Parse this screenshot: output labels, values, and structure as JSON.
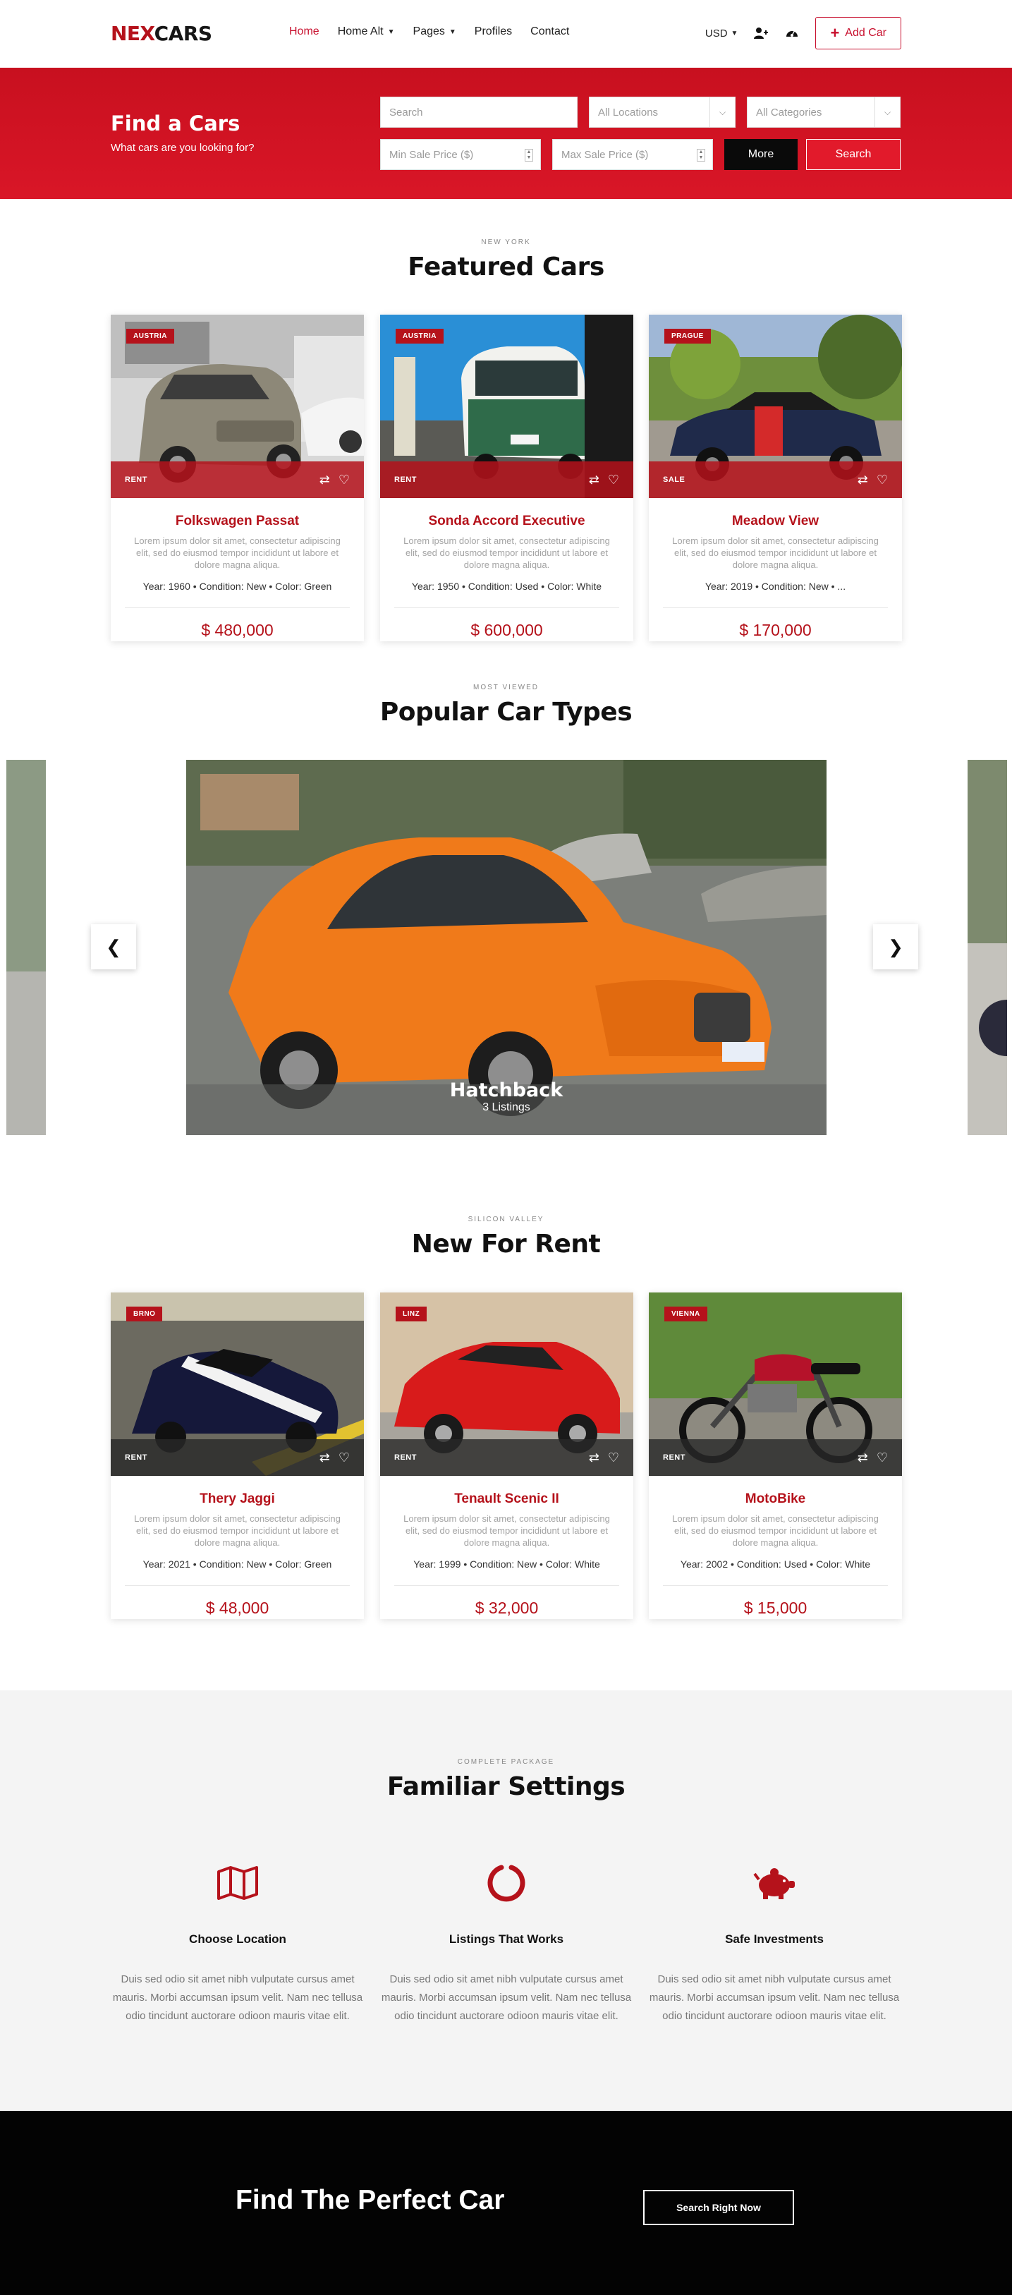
{
  "header": {
    "logo_part1": "NEX",
    "logo_part2": "CARS",
    "nav": [
      "Home",
      "Home Alt",
      "Pages",
      "Profiles",
      "Contact"
    ],
    "currency": "USD",
    "add_car_label": "Add Car"
  },
  "search": {
    "title": "Find a Cars",
    "subtitle": "What cars are you looking for?",
    "search_placeholder": "Search",
    "locations_placeholder": "All Locations",
    "categories_placeholder": "All Categories",
    "min_price_placeholder": "Min Sale Price ($)",
    "max_price_placeholder": "Max Sale Price ($)",
    "more_label": "More",
    "search_label": "Search"
  },
  "featured": {
    "eyebrow": "NEW YORK",
    "title": "Featured Cars",
    "cards": [
      {
        "tag": "AUSTRIA",
        "type": "RENT",
        "name": "Folkswagen Passat",
        "desc": "Lorem ipsum dolor sit amet, consectetur adipiscing elit, sed do eiusmod tempor incididunt ut labore et dolore magna aliqua.",
        "specs": "Year: 1960  •  Condition: New  •  Color: Green",
        "price": "$ 480,000"
      },
      {
        "tag": "AUSTRIA",
        "type": "RENT",
        "name": "Sonda Accord Executive",
        "desc": "Lorem ipsum dolor sit amet, consectetur adipiscing elit, sed do eiusmod tempor incididunt ut labore et dolore magna aliqua.",
        "specs": "Year: 1950  •  Condition: Used  •  Color: White",
        "price": "$ 600,000"
      },
      {
        "tag": "PRAGUE",
        "type": "SALE",
        "name": "Meadow View",
        "desc": "Lorem ipsum dolor sit amet, consectetur adipiscing elit, sed do eiusmod tempor incididunt ut labore et dolore magna aliqua.",
        "specs": "Year: 2019  •  Condition: New  •  ...",
        "price": "$ 170,000"
      }
    ]
  },
  "popular": {
    "eyebrow": "MOST VIEWED",
    "title": "Popular Car Types",
    "slide_title": "Hatchback",
    "slide_count": "3 Listings"
  },
  "rent": {
    "eyebrow": "SILICON VALLEY",
    "title": "New For Rent",
    "cards": [
      {
        "tag": "BRNO",
        "type": "RENT",
        "name": "Thery Jaggi",
        "desc": "Lorem ipsum dolor sit amet, consectetur adipiscing elit, sed do eiusmod tempor incididunt ut labore et dolore magna aliqua.",
        "specs": "Year: 2021  •  Condition: New  •  Color: Green",
        "price": "$ 48,000"
      },
      {
        "tag": "LINZ",
        "type": "RENT",
        "name": "Tenault Scenic II",
        "desc": "Lorem ipsum dolor sit amet, consectetur adipiscing elit, sed do eiusmod tempor incididunt ut labore et dolore magna aliqua.",
        "specs": "Year: 1999  •  Condition: New  •  Color: White",
        "price": "$ 32,000"
      },
      {
        "tag": "VIENNA",
        "type": "RENT",
        "name": "MotoBike",
        "desc": "Lorem ipsum dolor sit amet, consectetur adipiscing elit, sed do eiusmod tempor incididunt ut labore et dolore magna aliqua.",
        "specs": "Year: 2002  •  Condition: Used  •  Color: White",
        "price": "$ 15,000"
      }
    ]
  },
  "settings": {
    "eyebrow": "COMPLETE PACKAGE",
    "title": "Familiar Settings",
    "features": [
      {
        "icon": "map-icon",
        "title": "Choose Location",
        "text": "Duis sed odio sit amet nibh vulputate cursus amet mauris. Morbi accumsan ipsum velit. Nam nec tellusa odio tincidunt auctorare odioon mauris vitae elit."
      },
      {
        "icon": "circle-notch-icon",
        "title": "Listings That Works",
        "text": "Duis sed odio sit amet nibh vulputate cursus amet mauris. Morbi accumsan ipsum velit. Nam nec tellusa odio tincidunt auctorare odioon mauris vitae elit."
      },
      {
        "icon": "piggy-bank-icon",
        "title": "Safe Investments",
        "text": "Duis sed odio sit amet nibh vulputate cursus amet mauris. Morbi accumsan ipsum velit. Nam nec tellusa odio tincidunt auctorare odioon mauris vitae elit."
      }
    ]
  },
  "cta": {
    "title": "Find The Perfect Car",
    "button": "Search Right Now"
  },
  "colors": {
    "brand_red": "#b5121b",
    "search_band": "#d3131f",
    "cta_black": "#030303"
  }
}
